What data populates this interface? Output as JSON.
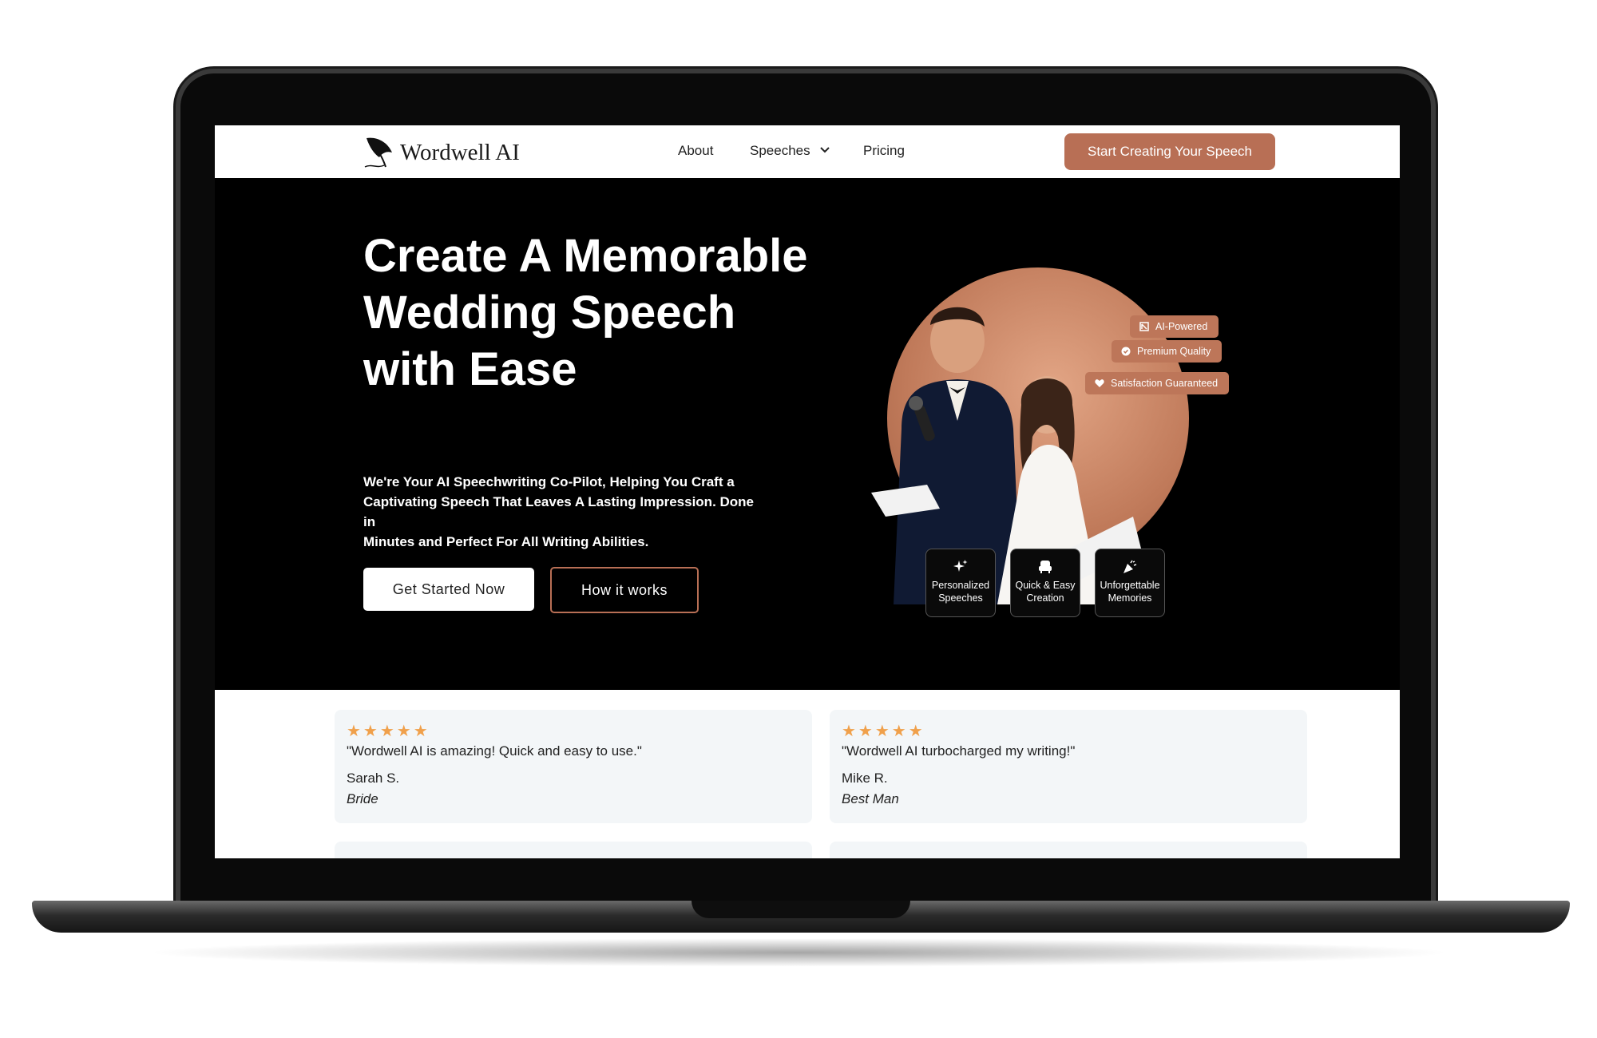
{
  "nav": {
    "logo_text": "Wordwell AI",
    "links": [
      {
        "label": "About"
      },
      {
        "label": "Speeches"
      },
      {
        "label": "Pricing"
      }
    ],
    "cta_label": "Start Creating Your Speech"
  },
  "hero": {
    "title_lines": [
      "Create A Memorable",
      "Wedding Speech",
      "with Ease"
    ],
    "subtitle_lines": [
      "We're Your AI Speechwriting Co-Pilot, Helping You Craft a",
      "Captivating Speech That Leaves A Lasting Impression. Done in",
      "Minutes and Perfect For All Writing Abilities."
    ],
    "primary_button": "Get Started Now",
    "secondary_button": "How it works"
  },
  "badges": [
    {
      "label": "AI-Powered",
      "icon": "brain-chip-icon"
    },
    {
      "label": "Premium Quality",
      "icon": "check-badge-icon"
    },
    {
      "label": "Satisfaction Guaranteed",
      "icon": "heart-icon"
    }
  ],
  "features": [
    {
      "line1": "Personalized",
      "line2": "Speeches",
      "icon": "sparkles-icon"
    },
    {
      "line1": "Quick & Easy",
      "line2": "Creation",
      "icon": "armchair-icon"
    },
    {
      "line1": "Unforgettable",
      "line2": "Memories",
      "icon": "party-popper-icon"
    }
  ],
  "testimonials": [
    {
      "stars": "★★★★★",
      "quote": "\"Wordwell AI is amazing! Quick and easy to use.\"",
      "name": "Sarah S.",
      "role": "Bride"
    },
    {
      "stars": "★★★★★",
      "quote": "\"Wordwell AI turbocharged my writing!\"",
      "name": "Mike R.",
      "role": "Best Man"
    }
  ],
  "colors": {
    "accent": "#b86f55",
    "background": "#000000",
    "star": "#f0a04b",
    "card": "#f3f6f8"
  }
}
